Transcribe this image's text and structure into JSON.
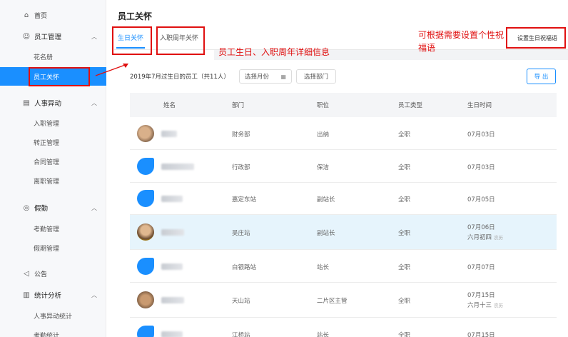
{
  "sidebar": {
    "home": "首页",
    "employee_mgmt": "员工管理",
    "roster": "花名册",
    "employee_care": "员工关怀",
    "hr_changes": "人事异动",
    "onboarding": "入职管理",
    "regularization": "转正管理",
    "contract": "合同管理",
    "resignation": "离职管理",
    "attendance": "假勤",
    "attendance_mgmt": "考勤管理",
    "leave_mgmt": "假期管理",
    "announcement": "公告",
    "stats": "统计分析",
    "hr_change_stats": "人事异动统计",
    "attendance_stats": "考勤统计"
  },
  "page": {
    "title": "员工关怀",
    "tab_birthday": "生日关怀",
    "tab_anniversary": "入职周年关怀",
    "setting_button": "设置生日祝福语",
    "filter_text": "2019年7月过生日的员工（共11人）",
    "month_placeholder": "选择月份",
    "dept_button": "选择部门",
    "export_button": "导 出"
  },
  "annotations": {
    "detail": "员工生日、入职周年详细信息",
    "greeting": "可根据需要设置个性祝福语"
  },
  "table": {
    "columns": [
      "姓名",
      "部门",
      "职位",
      "员工类型",
      "生日时间"
    ],
    "rows": [
      {
        "dept": "财务部",
        "position": "出纳",
        "type": "全职",
        "date": "07月03日"
      },
      {
        "dept": "行政部",
        "position": "保洁",
        "type": "全职",
        "date": "07月03日"
      },
      {
        "dept": "嘉定东站",
        "position": "副站长",
        "type": "全职",
        "date": "07月05日"
      },
      {
        "dept": "吴庄站",
        "position": "副站长",
        "type": "全职",
        "date": "07月06日",
        "lunar": "六月初四",
        "tag": "农历"
      },
      {
        "dept": "白银路站",
        "position": "站长",
        "type": "全职",
        "date": "07月07日"
      },
      {
        "dept": "天山站",
        "position": "二片区主管",
        "type": "全职",
        "date": "07月15日",
        "lunar": "六月十三",
        "tag": "农历"
      },
      {
        "dept": "江桥站",
        "position": "站长",
        "type": "全职",
        "date": "07月15日"
      }
    ]
  },
  "colors": {
    "accent": "#1a8fff",
    "annotation": "#e01010",
    "highlight_row": "#e6f4fc"
  }
}
